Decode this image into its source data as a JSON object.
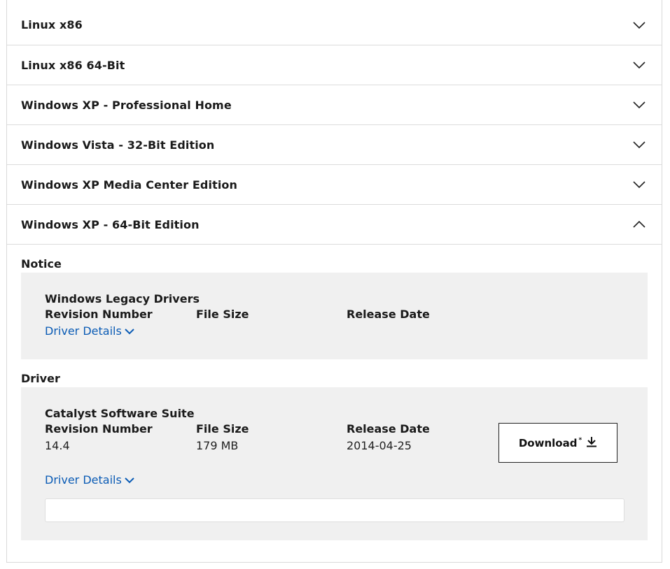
{
  "accordion": {
    "items": [
      {
        "label": "Linux x86",
        "state": "collapsed"
      },
      {
        "label": "Linux x86 64-Bit",
        "state": "collapsed"
      },
      {
        "label": "Windows XP - Professional Home",
        "state": "collapsed"
      },
      {
        "label": "Windows Vista - 32-Bit Edition",
        "state": "collapsed"
      },
      {
        "label": "Windows XP Media Center Edition",
        "state": "collapsed"
      },
      {
        "label": "Windows XP - 64-Bit Edition",
        "state": "expanded"
      }
    ]
  },
  "expanded": {
    "notice": {
      "section_title": "Notice",
      "card_title": "Windows Legacy Drivers",
      "revision_header": "Revision Number",
      "size_header": "File Size",
      "date_header": "Release Date",
      "details_link": "Driver Details"
    },
    "driver": {
      "section_title": "Driver",
      "card_title": "Catalyst Software Suite",
      "revision_header": "Revision Number",
      "size_header": "File Size",
      "date_header": "Release Date",
      "revision": "14.4",
      "size": "179 MB",
      "date": "2014-04-25",
      "download_label": "Download",
      "download_mark": "*",
      "details_link": "Driver Details"
    }
  },
  "colors": {
    "link": "#0a5bb5",
    "card_bg": "#f0f0f0",
    "divider": "#dcdcdc"
  },
  "icons": {
    "chevron_down": "chevron-down-icon",
    "chevron_up": "chevron-up-icon",
    "download": "download-icon"
  }
}
